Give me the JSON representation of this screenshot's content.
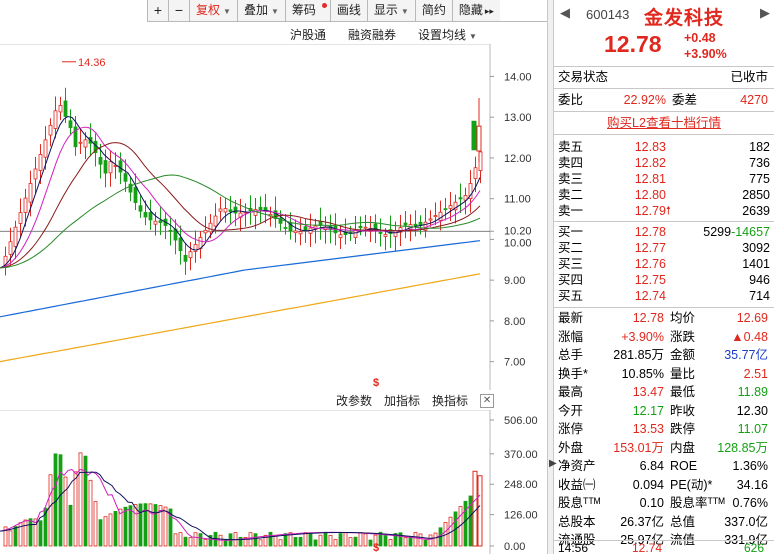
{
  "toolbar": {
    "plus": "+",
    "minus": "−",
    "adjust": "复权",
    "overlay": "叠加",
    "chips": "筹码",
    "draw": "画线",
    "display": "显示",
    "compact": "简约",
    "hide": "隐藏",
    "more": "▸▸"
  },
  "subbar": {
    "hsgt": "沪股通",
    "margin": "融资融券",
    "ma_settings": "设置均线"
  },
  "indicator_bar": {
    "change_params": "改参数",
    "add_indicator": "加指标",
    "switch_indicator": "换指标",
    "close": "✕"
  },
  "main_chart_labels": {
    "high_marker": "14.36",
    "y_ticks": [
      "14.00",
      "13.00",
      "12.00",
      "11.00",
      "10.20",
      "10.00",
      "9.00",
      "8.00",
      "7.00"
    ],
    "dividend_marker": "$"
  },
  "vol_chart_labels": {
    "y_ticks": [
      "506.00",
      "370.00",
      "248.00",
      "126.00",
      "0.00"
    ],
    "dividend_marker": "$"
  },
  "quote": {
    "code": "600143",
    "name": "金发科技",
    "price": "12.78",
    "change": "+0.48",
    "change_pct": "+3.90%",
    "status_label": "交易状态",
    "status_value": "已收市",
    "weibi_label": "委比",
    "weibi_value": "22.92%",
    "weicha_label": "委差",
    "weicha_value": "4270",
    "l2_link": "购买L2查看十档行情",
    "asks": [
      {
        "label": "卖五",
        "price": "12.83",
        "vol": "182"
      },
      {
        "label": "卖四",
        "price": "12.82",
        "vol": "736"
      },
      {
        "label": "卖三",
        "price": "12.81",
        "vol": "775"
      },
      {
        "label": "卖二",
        "price": "12.80",
        "vol": "2850"
      },
      {
        "label": "卖一",
        "price": "12.79",
        "vol": "2639",
        "arrow": "🠕"
      }
    ],
    "bids": [
      {
        "label": "买一",
        "price": "12.78",
        "vol": "5299",
        "extra": "-14657"
      },
      {
        "label": "买二",
        "price": "12.77",
        "vol": "3092"
      },
      {
        "label": "买三",
        "price": "12.76",
        "vol": "1401"
      },
      {
        "label": "买四",
        "price": "12.75",
        "vol": "946"
      },
      {
        "label": "买五",
        "price": "12.74",
        "vol": "714"
      }
    ],
    "stats": [
      {
        "k": "最新",
        "v": "12.78",
        "vc": "red",
        "k2": "均价",
        "v2": "12.69",
        "v2c": "red"
      },
      {
        "k": "涨幅",
        "v": "+3.90%",
        "vc": "red",
        "k2": "涨跌",
        "v2": "▲0.48",
        "v2c": "red"
      },
      {
        "k": "总手",
        "v": "281.85万",
        "vc": "",
        "k2": "金额",
        "v2": "35.77亿",
        "v2c": "blue"
      },
      {
        "k": "换手*",
        "v": "10.85%",
        "vc": "",
        "k2": "量比",
        "v2": "2.51",
        "v2c": "red"
      },
      {
        "k": "最高",
        "v": "13.47",
        "vc": "red",
        "k2": "最低",
        "v2": "11.89",
        "v2c": "green"
      },
      {
        "k": "今开",
        "v": "12.17",
        "vc": "green",
        "k2": "昨收",
        "v2": "12.30",
        "v2c": ""
      },
      {
        "k": "涨停",
        "v": "13.53",
        "vc": "red",
        "k2": "跌停",
        "v2": "11.07",
        "v2c": "green"
      },
      {
        "k": "外盘",
        "v": "153.01万",
        "vc": "red",
        "k2": "内盘",
        "v2": "128.85万",
        "v2c": "green"
      },
      {
        "k": "净资产",
        "v": "6.84",
        "vc": "",
        "k2": "ROE",
        "v2": "1.36%",
        "v2c": ""
      },
      {
        "k": "收益㈠",
        "v": "0.094",
        "vc": "",
        "k2": "PE(动)*",
        "v2": "34.16",
        "v2c": ""
      },
      {
        "k": "股息ᵀᵀᴹ",
        "v": "0.10",
        "vc": "",
        "k2": "股息率ᵀᵀᴹ",
        "v2": "0.76%",
        "v2c": ""
      },
      {
        "k": "总股本",
        "v": "26.37亿",
        "vc": "",
        "k2": "总值",
        "v2": "337.0亿",
        "v2c": ""
      },
      {
        "k": "流通股",
        "v": "25.97亿",
        "vc": "",
        "k2": "流值",
        "v2": "331.9亿",
        "v2c": ""
      }
    ],
    "last_tick": {
      "time": "14:56",
      "price": "12.74",
      "vol": "626"
    }
  },
  "colors": {
    "up": "#e0281e",
    "down": "#14a014",
    "accent_blue": "#1a3cc8"
  }
}
